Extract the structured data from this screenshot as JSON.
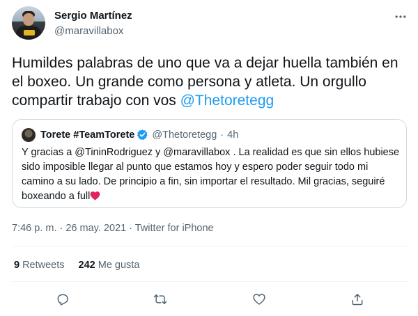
{
  "author": {
    "name": "Sergio Martínez",
    "handle": "@maravillabox"
  },
  "tweet": {
    "text_before": "Humildes palabras de uno que va  a dejar huella también en el boxeo. Un grande como persona y atleta. Un orgullo compartir trabajo con vos ",
    "mention": "@Thetoretegg"
  },
  "quoted": {
    "name": "Torete #TeamTorete",
    "handle": "@Thetoretegg",
    "separator": "·",
    "time": "4h",
    "text": "Y gracias a @TininRodriguez  y  @maravillabox . La realidad es que sin ellos hubiese sido imposible llegar al punto que estamos hoy y espero poder seguir todo mi camino a su lado. De principio a fin, sin importar el resultado. Mil gracias, seguiré boxeando a full",
    "emoji_icon": "red-heart-icon"
  },
  "meta": {
    "timestamp": "7:46 p. m. · 26 may. 2021 · Twitter for iPhone"
  },
  "stats": {
    "retweets_count": "9",
    "retweets_label": "Retweets",
    "likes_count": "242",
    "likes_label": "Me gusta"
  },
  "actions": [
    "reply-icon",
    "retweet-icon",
    "like-icon",
    "share-icon"
  ],
  "colors": {
    "link": "#1d9bf0",
    "secondary_text": "#536471",
    "heart": "#e0245e",
    "border": "#cfd9de"
  }
}
